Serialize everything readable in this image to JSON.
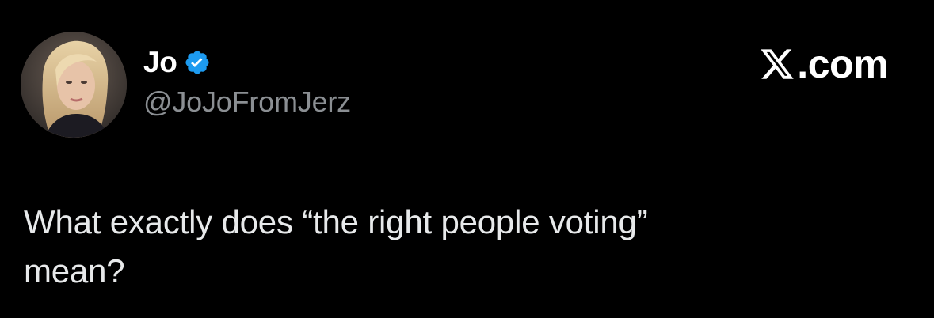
{
  "tweet": {
    "author": {
      "display_name": "Jo",
      "handle": "@JoJoFromJerz",
      "verified": true,
      "avatar_icon": "avatar-photo"
    },
    "brand": {
      "label": ".com",
      "icon": "x-logo-icon"
    },
    "text_line1": "What exactly does “the right people voting”",
    "text_line2": "mean?"
  },
  "colors": {
    "background": "#000000",
    "name": "#ffffff",
    "handle": "#8b8f93",
    "text": "#e7e9ea",
    "verified": "#1d9bf0"
  }
}
